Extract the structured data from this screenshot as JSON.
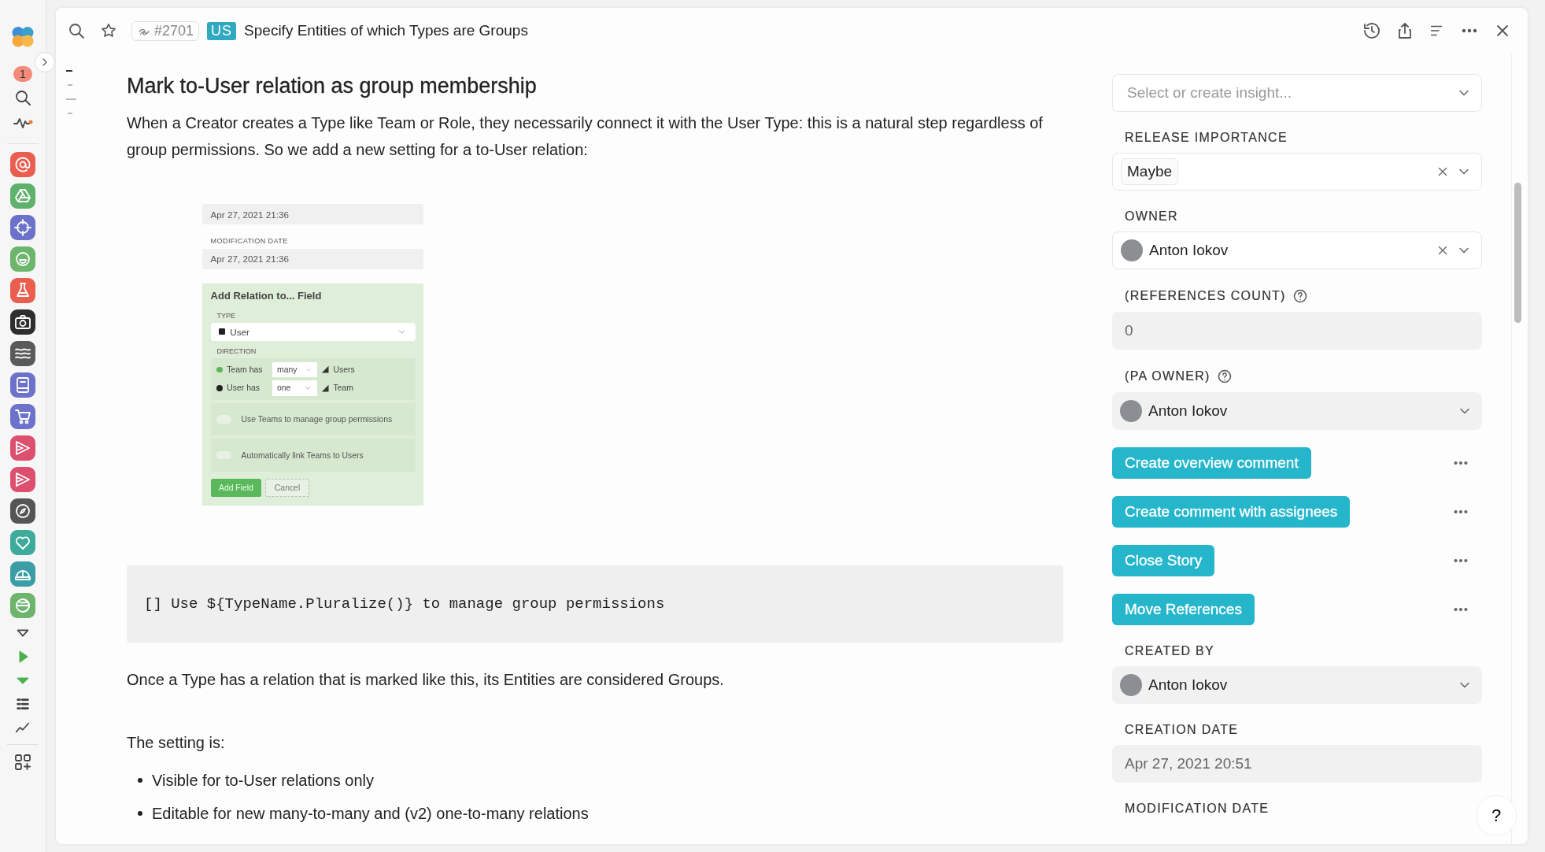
{
  "sidebar": {
    "notification_count": "1",
    "apps": [
      {
        "color": "#ea5e4f"
      },
      {
        "color": "#5fb26c"
      },
      {
        "color": "#6c72c9"
      },
      {
        "color": "#6db56d"
      },
      {
        "color": "#ea5e4f"
      },
      {
        "color": "#2e2e2e"
      },
      {
        "color": "#5a5a5a"
      },
      {
        "color": "#6c72c9"
      },
      {
        "color": "#6c72c9"
      },
      {
        "color": "#dc4f6e"
      },
      {
        "color": "#dc4f6e"
      },
      {
        "color": "#555555"
      },
      {
        "color": "#3eaa9c"
      },
      {
        "color": "#3b9ea6"
      },
      {
        "color": "#6db56d"
      }
    ]
  },
  "header": {
    "ref": "#2701",
    "badge": "US",
    "title": "Specify Entities of which Types are Groups"
  },
  "content": {
    "heading": "Mark to-User relation as group membership",
    "intro": "When a Creator creates a Type like Team or Role, they necessarily connect it with the User Type: this is a natural step regardless of group permissions. So we add a new setting for a to-User relation:",
    "embedded_screenshot": {
      "top_date": "Apr 27, 2021 21:36",
      "modification_label": "MODIFICATION DATE",
      "modification_value": "Apr 27, 2021 21:36",
      "dialog": {
        "title": "Add Relation to... Field",
        "type_label": "TYPE",
        "type_value": "User",
        "direction_label": "DIRECTION",
        "directions": [
          {
            "subject": "Team has",
            "count": "many",
            "object": "Users",
            "color": "#5cb85c"
          },
          {
            "subject": "User has",
            "count": "one",
            "object": "Team",
            "color": "#222222"
          }
        ],
        "options": [
          {
            "label": "Use Teams to manage group permissions",
            "checked": false
          },
          {
            "label": "Automatically link Teams to Users",
            "checked": false
          }
        ],
        "buttons": [
          {
            "label": "Add Field",
            "kind": "primary"
          },
          {
            "label": "Cancel",
            "kind": "secondary"
          }
        ]
      }
    },
    "code": "[] Use ${TypeName.Pluralize()} to manage group permissions",
    "after_code": "Once a Type has a relation that is marked like this, its Entities are considered Groups.",
    "setting_intro": "The setting is:",
    "bullets": [
      "Visible for to-User relations only",
      "Editable for new many-to-many and (v2) one-to-many relations"
    ]
  },
  "panel": {
    "items": [
      {
        "kind": "select",
        "placeholder": "Select or create insight..."
      },
      {
        "kind": "tag",
        "label": "RELEASE IMPORTANCE",
        "value": "Maybe",
        "clearable": true
      },
      {
        "kind": "user",
        "label": "OWNER",
        "value": "Anton Iokov",
        "clearable": true,
        "readonly": false
      },
      {
        "kind": "text",
        "label": "(REFERENCES COUNT)",
        "help": true,
        "value": "0"
      },
      {
        "kind": "user",
        "label": "(PA OWNER)",
        "help": true,
        "value": "Anton Iokov",
        "clearable": false,
        "readonly": true
      },
      {
        "kind": "action",
        "label": "Create overview comment"
      },
      {
        "kind": "action",
        "label": "Create comment with assignees"
      },
      {
        "kind": "action",
        "label": "Close Story"
      },
      {
        "kind": "action",
        "label": "Move References"
      },
      {
        "kind": "user",
        "label": "CREATED BY",
        "value": "Anton Iokov",
        "clearable": false,
        "readonly": true
      },
      {
        "kind": "text",
        "label": "CREATION DATE",
        "value": "Apr 27, 2021 20:51"
      },
      {
        "kind": "label",
        "label": "MODIFICATION DATE"
      }
    ]
  },
  "help_button": "?"
}
